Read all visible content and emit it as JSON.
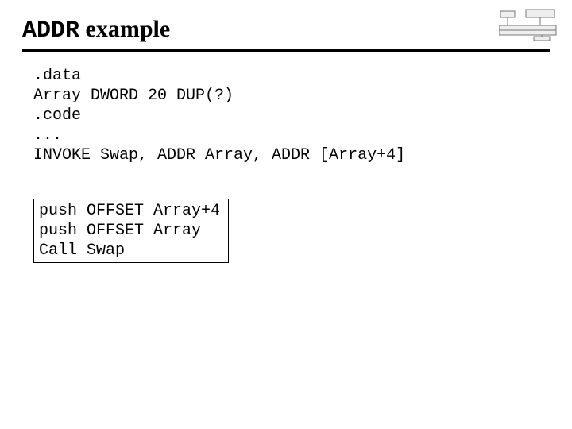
{
  "title": {
    "mono": "ADDR",
    "rest": " example"
  },
  "code": {
    "l1": ".data",
    "l2": "Array DWORD 20 DUP(?)",
    "l3": ".code",
    "l4": "...",
    "l5": "INVOKE Swap, ADDR Array, ADDR [Array+4]"
  },
  "box": {
    "l1": "push OFFSET Array+4",
    "l2": "push OFFSET Array",
    "l3": "Call Swap"
  }
}
